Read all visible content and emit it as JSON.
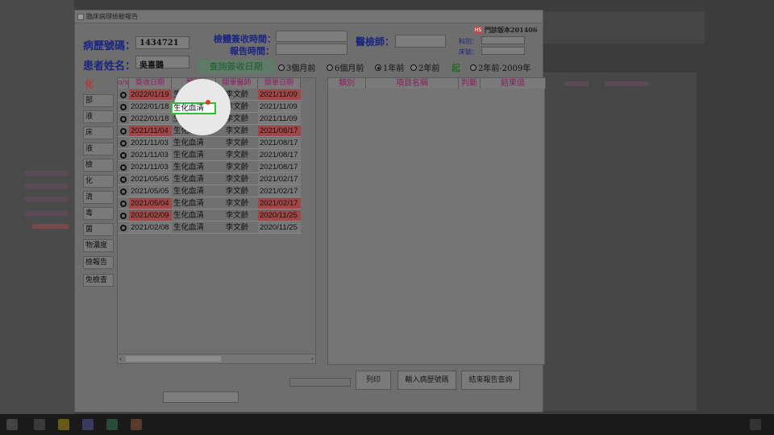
{
  "window": {
    "title": "臨床病理檢驗報告"
  },
  "header": {
    "chart_no_label": "病歷號碼：",
    "chart_no": "1434721",
    "patient_label": "患者姓名：",
    "patient_name": "吳喜鵲",
    "collect_time_label": "檢體簽收時間：",
    "report_time_label": "報告時間：",
    "technician_label": "醫檢師：",
    "badge": "HS",
    "version": "門診版本201406",
    "dept_label": "科別：",
    "bed_label": "床號："
  },
  "query": {
    "button_label": "查詢簽收日期",
    "options": [
      "3個月前",
      "6個月前",
      "1年前",
      "2年前",
      "2年前-2009年"
    ],
    "selected": "1年前",
    "qi_label": "起"
  },
  "sidebar": {
    "items": [
      "化",
      "部",
      "液",
      "床",
      "液",
      "檢",
      "化",
      "清",
      "毒",
      "菌",
      "物濃度",
      "檢報告",
      "免檢查"
    ]
  },
  "left_table": {
    "headers": [
      "o/x",
      "簽收日期",
      "類別",
      "開單醫師",
      "開單日期"
    ],
    "rows": [
      {
        "date": "2022/01/19",
        "date_red": true,
        "type": "生化血清",
        "doctor": "李文齡",
        "order_date": "2021/11/09",
        "order_red": true
      },
      {
        "date": "2022/01/18",
        "date_red": false,
        "type": "生化血清",
        "doctor": "李文齡",
        "order_date": "2021/11/09",
        "order_red": false
      },
      {
        "date": "2022/01/18",
        "date_red": false,
        "type": "生化血清",
        "doctor": "李文齡",
        "order_date": "2021/11/09",
        "order_red": false
      },
      {
        "date": "2021/11/04",
        "date_red": true,
        "type": "生化血清",
        "doctor": "李文齡",
        "order_date": "2021/08/17",
        "order_red": true
      },
      {
        "date": "2021/11/03",
        "date_red": false,
        "type": "生化血清",
        "doctor": "李文齡",
        "order_date": "2021/08/17",
        "order_red": false
      },
      {
        "date": "2021/11/03",
        "date_red": false,
        "type": "生化血清",
        "doctor": "李文齡",
        "order_date": "2021/08/17",
        "order_red": false
      },
      {
        "date": "2021/11/03",
        "date_red": false,
        "type": "生化血清",
        "doctor": "李文齡",
        "order_date": "2021/08/17",
        "order_red": false
      },
      {
        "date": "2021/05/05",
        "date_red": false,
        "type": "生化血清",
        "doctor": "李文齡",
        "order_date": "2021/02/17",
        "order_red": false
      },
      {
        "date": "2021/05/05",
        "date_red": false,
        "type": "生化血清",
        "doctor": "李文齡",
        "order_date": "2021/02/17",
        "order_red": false
      },
      {
        "date": "2021/05/04",
        "date_red": true,
        "type": "生化血清",
        "doctor": "李文齡",
        "order_date": "2021/02/17",
        "order_red": true
      },
      {
        "date": "2021/02/09",
        "date_red": true,
        "type": "生化血清",
        "doctor": "李文齡",
        "order_date": "2020/11/25",
        "order_red": true
      },
      {
        "date": "2021/02/08",
        "date_red": false,
        "type": "生化血清",
        "doctor": "李文齡",
        "order_date": "2020/11/25",
        "order_red": false
      }
    ]
  },
  "right_table": {
    "headers": [
      "類別",
      "項目名稱",
      "判斷",
      "結果值"
    ]
  },
  "buttons": {
    "print": "列印",
    "enter_chart": "輸入病歷號碼",
    "end_query": "結束報告查詢"
  },
  "colors": {
    "highlight_red": "#a04848",
    "selection_green": "#2bbf3a",
    "cursor": "#e2381e",
    "label_blue": "#1a2580"
  }
}
